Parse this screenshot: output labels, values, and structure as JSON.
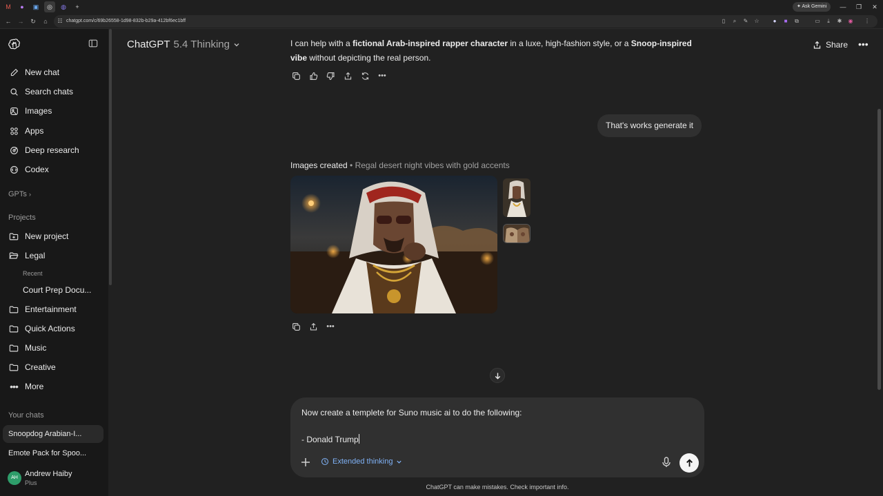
{
  "browser": {
    "url": "chatgpt.com/c/69b26558-1d98-832b-b29a-412bf6ec1bff",
    "ask_gemini": "Ask Gemini",
    "tabs": [
      "M",
      "●",
      "▣",
      "◎",
      "◍"
    ],
    "new_tab": "+"
  },
  "sidebar": {
    "nav": [
      {
        "label": "New chat",
        "icon": "edit-icon"
      },
      {
        "label": "Search chats",
        "icon": "search-icon"
      },
      {
        "label": "Images",
        "icon": "images-icon"
      },
      {
        "label": "Apps",
        "icon": "apps-icon"
      },
      {
        "label": "Deep research",
        "icon": "deep-research-icon"
      },
      {
        "label": "Codex",
        "icon": "codex-icon"
      }
    ],
    "gpts_label": "GPTs",
    "projects_label": "Projects",
    "projects": [
      {
        "label": "New project",
        "icon": "folder-plus-icon"
      },
      {
        "label": "Legal",
        "icon": "folder-open-icon"
      }
    ],
    "recent_label": "Recent",
    "recent_item": "Court Prep Docu...",
    "more_projects": [
      {
        "label": "Entertainment",
        "icon": "folder-icon"
      },
      {
        "label": "Quick Actions",
        "icon": "folder-icon"
      },
      {
        "label": "Music",
        "icon": "folder-icon"
      },
      {
        "label": "Creative",
        "icon": "folder-icon"
      },
      {
        "label": "More",
        "icon": "more-icon"
      }
    ],
    "your_chats_label": "Your chats",
    "chats": [
      "Snoopdog Arabian-I...",
      "Emote Pack for Spoo..."
    ],
    "user": {
      "initials": "AH",
      "name": "Andrew Haiby",
      "plan": "Plus"
    }
  },
  "header": {
    "model": "ChatGPT",
    "variant": "5.4 Thinking",
    "share_label": "Share"
  },
  "messages": {
    "assistant_intro": {
      "p1": "I can help with a ",
      "b1": "fictional Arab-inspired rapper character",
      "p2": " in a luxe, high-fashion style, or a ",
      "b2": "Snoop-inspired vibe",
      "p3": " without depicting the real person."
    },
    "user_message": "That's works generate it",
    "images_created_label": "Images created",
    "images_created_sep": " • ",
    "images_created_desc": "Regal desert night vibes with gold accents"
  },
  "composer": {
    "line1": "Now create a templete for Suno music ai to do the following:",
    "line2": "- Donald Trump",
    "mode_label": "Extended thinking"
  },
  "footer": {
    "disclaimer": "ChatGPT can make mistakes. Check important info."
  },
  "colors": {
    "background": "#212121",
    "sidebar": "#181818",
    "composer": "#303030",
    "accent_link": "#7fb1f5",
    "avatar": "#2e9d6a"
  }
}
